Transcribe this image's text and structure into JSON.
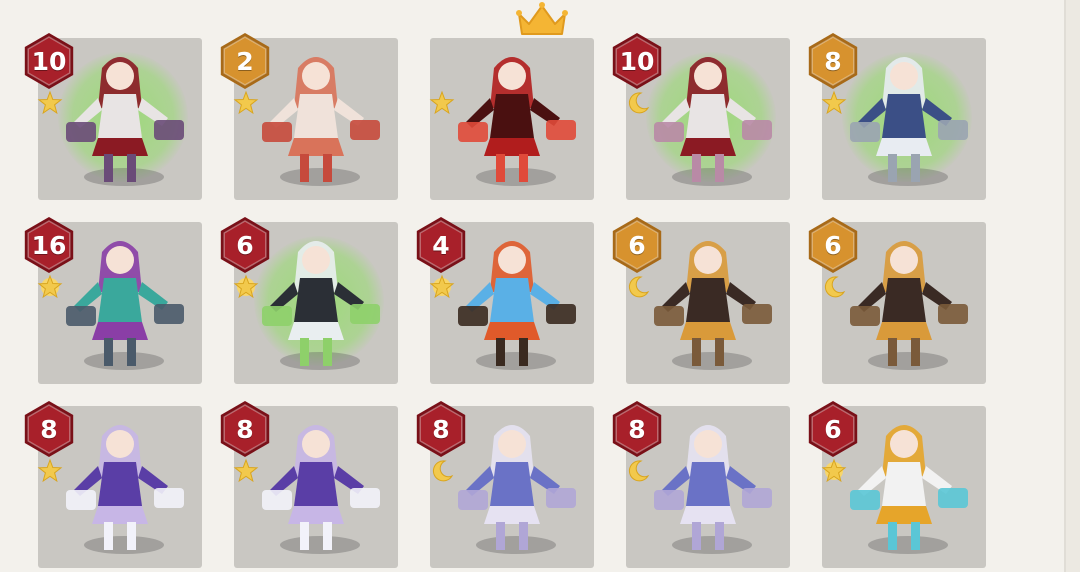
{
  "colors": {
    "badge_red": "#a8202a",
    "badge_red_ring": "#7a1018",
    "badge_gold": "#d7922e",
    "badge_gold_ring": "#a86a18",
    "star_yellow": "#f2c94c",
    "crown_gold": "#f4b534"
  },
  "top_icon": "crown-icon",
  "heroes": [
    {
      "level": "10",
      "badge": "red",
      "rank_icon": "star-icon",
      "glow": true,
      "palette": [
        "#8b1a23",
        "#e8e4e4",
        "#6a4b78"
      ]
    },
    {
      "level": "2",
      "badge": "gold",
      "rank_icon": "star-icon",
      "glow": false,
      "palette": [
        "#d9735a",
        "#f0e2da",
        "#c64a3c"
      ]
    },
    {
      "level": "",
      "badge": "none",
      "rank_icon": "star-icon",
      "glow": false,
      "palette": [
        "#b11d1d",
        "#4a1010",
        "#e04a3a"
      ]
    },
    {
      "level": "10",
      "badge": "red",
      "rank_icon": "moon-icon",
      "glow": true,
      "palette": [
        "#8b1a23",
        "#e8e4e4",
        "#b98aa6"
      ]
    },
    {
      "level": "8",
      "badge": "gold",
      "rank_icon": "star-icon",
      "glow": true,
      "palette": [
        "#e8ecf2",
        "#3b4f86",
        "#9aa4b1"
      ]
    },
    {
      "level": "16",
      "badge": "red",
      "rank_icon": "sun-star-icon",
      "glow": false,
      "palette": [
        "#8a3ea6",
        "#3aa89c",
        "#4a5a6a"
      ]
    },
    {
      "level": "6",
      "badge": "red",
      "rank_icon": "sun-star-icon",
      "glow": true,
      "palette": [
        "#e9eef0",
        "#2b2f36",
        "#8ed06a"
      ]
    },
    {
      "level": "4",
      "badge": "red",
      "rank_icon": "sun-star-icon",
      "glow": false,
      "palette": [
        "#e05a2a",
        "#5ab0e6",
        "#3a2a20"
      ]
    },
    {
      "level": "6",
      "badge": "gold",
      "rank_icon": "moon-icon",
      "glow": false,
      "palette": [
        "#d99a3a",
        "#3a2a24",
        "#7a5a3a"
      ]
    },
    {
      "level": "6",
      "badge": "gold",
      "rank_icon": "moon-icon",
      "glow": false,
      "palette": [
        "#d99a3a",
        "#3a2a24",
        "#7a5a3a"
      ]
    },
    {
      "level": "8",
      "badge": "red",
      "rank_icon": "star-icon",
      "glow": false,
      "palette": [
        "#c7b6e6",
        "#5a3ea6",
        "#f2f2fa"
      ]
    },
    {
      "level": "8",
      "badge": "red",
      "rank_icon": "star-icon",
      "glow": false,
      "palette": [
        "#c7b6e6",
        "#5a3ea6",
        "#f2f2fa"
      ]
    },
    {
      "level": "8",
      "badge": "red",
      "rank_icon": "moon-icon",
      "glow": false,
      "palette": [
        "#e6e2f2",
        "#6a72c6",
        "#b0a6d6"
      ]
    },
    {
      "level": "8",
      "badge": "red",
      "rank_icon": "moon-icon",
      "glow": false,
      "palette": [
        "#e6e2f2",
        "#6a72c6",
        "#b0a6d6"
      ]
    },
    {
      "level": "6",
      "badge": "red",
      "rank_icon": "sun-star-icon",
      "glow": false,
      "palette": [
        "#e6a52a",
        "#f2f2f2",
        "#5ac6d6"
      ]
    }
  ]
}
